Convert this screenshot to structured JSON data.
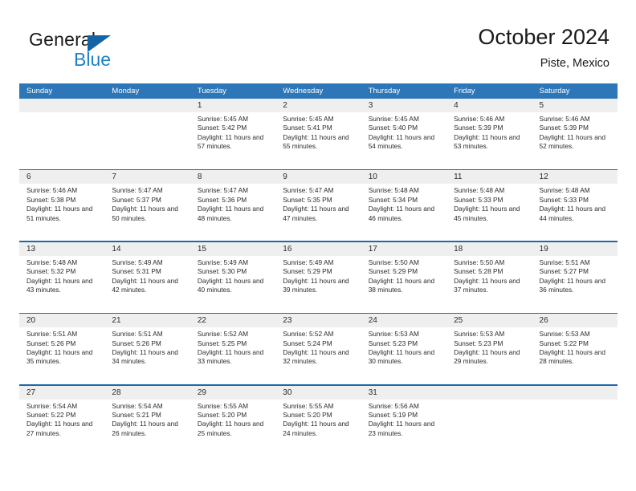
{
  "brand": {
    "name_part1": "General",
    "name_part2": "Blue",
    "triangle_icon": "triangle-icon",
    "accent_color": "#1f7fc4"
  },
  "header": {
    "title": "October 2024",
    "subtitle": "Piste, Mexico"
  },
  "colors": {
    "header_blue": "#2d76b8",
    "rule_blue": "#1f68ad",
    "daynum_band": "#efefef",
    "text": "#2b2b2b"
  },
  "weekdays": [
    "Sunday",
    "Monday",
    "Tuesday",
    "Wednesday",
    "Thursday",
    "Friday",
    "Saturday"
  ],
  "labels": {
    "sunrise_prefix": "Sunrise:",
    "sunset_prefix": "Sunset:",
    "daylight_prefix": "Daylight:"
  },
  "weeks": [
    {
      "days": [
        {
          "num": "",
          "sunrise": "",
          "sunset": "",
          "daylight": "",
          "empty": true
        },
        {
          "num": "",
          "sunrise": "",
          "sunset": "",
          "daylight": "",
          "empty": true
        },
        {
          "num": "1",
          "sunrise": "Sunrise: 5:45 AM",
          "sunset": "Sunset: 5:42 PM",
          "daylight": "Daylight: 11 hours and 57 minutes."
        },
        {
          "num": "2",
          "sunrise": "Sunrise: 5:45 AM",
          "sunset": "Sunset: 5:41 PM",
          "daylight": "Daylight: 11 hours and 55 minutes."
        },
        {
          "num": "3",
          "sunrise": "Sunrise: 5:45 AM",
          "sunset": "Sunset: 5:40 PM",
          "daylight": "Daylight: 11 hours and 54 minutes."
        },
        {
          "num": "4",
          "sunrise": "Sunrise: 5:46 AM",
          "sunset": "Sunset: 5:39 PM",
          "daylight": "Daylight: 11 hours and 53 minutes."
        },
        {
          "num": "5",
          "sunrise": "Sunrise: 5:46 AM",
          "sunset": "Sunset: 5:39 PM",
          "daylight": "Daylight: 11 hours and 52 minutes."
        }
      ]
    },
    {
      "days": [
        {
          "num": "6",
          "sunrise": "Sunrise: 5:46 AM",
          "sunset": "Sunset: 5:38 PM",
          "daylight": "Daylight: 11 hours and 51 minutes."
        },
        {
          "num": "7",
          "sunrise": "Sunrise: 5:47 AM",
          "sunset": "Sunset: 5:37 PM",
          "daylight": "Daylight: 11 hours and 50 minutes."
        },
        {
          "num": "8",
          "sunrise": "Sunrise: 5:47 AM",
          "sunset": "Sunset: 5:36 PM",
          "daylight": "Daylight: 11 hours and 48 minutes."
        },
        {
          "num": "9",
          "sunrise": "Sunrise: 5:47 AM",
          "sunset": "Sunset: 5:35 PM",
          "daylight": "Daylight: 11 hours and 47 minutes."
        },
        {
          "num": "10",
          "sunrise": "Sunrise: 5:48 AM",
          "sunset": "Sunset: 5:34 PM",
          "daylight": "Daylight: 11 hours and 46 minutes."
        },
        {
          "num": "11",
          "sunrise": "Sunrise: 5:48 AM",
          "sunset": "Sunset: 5:33 PM",
          "daylight": "Daylight: 11 hours and 45 minutes."
        },
        {
          "num": "12",
          "sunrise": "Sunrise: 5:48 AM",
          "sunset": "Sunset: 5:33 PM",
          "daylight": "Daylight: 11 hours and 44 minutes."
        }
      ]
    },
    {
      "days": [
        {
          "num": "13",
          "sunrise": "Sunrise: 5:48 AM",
          "sunset": "Sunset: 5:32 PM",
          "daylight": "Daylight: 11 hours and 43 minutes."
        },
        {
          "num": "14",
          "sunrise": "Sunrise: 5:49 AM",
          "sunset": "Sunset: 5:31 PM",
          "daylight": "Daylight: 11 hours and 42 minutes."
        },
        {
          "num": "15",
          "sunrise": "Sunrise: 5:49 AM",
          "sunset": "Sunset: 5:30 PM",
          "daylight": "Daylight: 11 hours and 40 minutes."
        },
        {
          "num": "16",
          "sunrise": "Sunrise: 5:49 AM",
          "sunset": "Sunset: 5:29 PM",
          "daylight": "Daylight: 11 hours and 39 minutes."
        },
        {
          "num": "17",
          "sunrise": "Sunrise: 5:50 AM",
          "sunset": "Sunset: 5:29 PM",
          "daylight": "Daylight: 11 hours and 38 minutes."
        },
        {
          "num": "18",
          "sunrise": "Sunrise: 5:50 AM",
          "sunset": "Sunset: 5:28 PM",
          "daylight": "Daylight: 11 hours and 37 minutes."
        },
        {
          "num": "19",
          "sunrise": "Sunrise: 5:51 AM",
          "sunset": "Sunset: 5:27 PM",
          "daylight": "Daylight: 11 hours and 36 minutes."
        }
      ]
    },
    {
      "days": [
        {
          "num": "20",
          "sunrise": "Sunrise: 5:51 AM",
          "sunset": "Sunset: 5:26 PM",
          "daylight": "Daylight: 11 hours and 35 minutes."
        },
        {
          "num": "21",
          "sunrise": "Sunrise: 5:51 AM",
          "sunset": "Sunset: 5:26 PM",
          "daylight": "Daylight: 11 hours and 34 minutes."
        },
        {
          "num": "22",
          "sunrise": "Sunrise: 5:52 AM",
          "sunset": "Sunset: 5:25 PM",
          "daylight": "Daylight: 11 hours and 33 minutes."
        },
        {
          "num": "23",
          "sunrise": "Sunrise: 5:52 AM",
          "sunset": "Sunset: 5:24 PM",
          "daylight": "Daylight: 11 hours and 32 minutes."
        },
        {
          "num": "24",
          "sunrise": "Sunrise: 5:53 AM",
          "sunset": "Sunset: 5:23 PM",
          "daylight": "Daylight: 11 hours and 30 minutes."
        },
        {
          "num": "25",
          "sunrise": "Sunrise: 5:53 AM",
          "sunset": "Sunset: 5:23 PM",
          "daylight": "Daylight: 11 hours and 29 minutes."
        },
        {
          "num": "26",
          "sunrise": "Sunrise: 5:53 AM",
          "sunset": "Sunset: 5:22 PM",
          "daylight": "Daylight: 11 hours and 28 minutes."
        }
      ]
    },
    {
      "days": [
        {
          "num": "27",
          "sunrise": "Sunrise: 5:54 AM",
          "sunset": "Sunset: 5:22 PM",
          "daylight": "Daylight: 11 hours and 27 minutes."
        },
        {
          "num": "28",
          "sunrise": "Sunrise: 5:54 AM",
          "sunset": "Sunset: 5:21 PM",
          "daylight": "Daylight: 11 hours and 26 minutes."
        },
        {
          "num": "29",
          "sunrise": "Sunrise: 5:55 AM",
          "sunset": "Sunset: 5:20 PM",
          "daylight": "Daylight: 11 hours and 25 minutes."
        },
        {
          "num": "30",
          "sunrise": "Sunrise: 5:55 AM",
          "sunset": "Sunset: 5:20 PM",
          "daylight": "Daylight: 11 hours and 24 minutes."
        },
        {
          "num": "31",
          "sunrise": "Sunrise: 5:56 AM",
          "sunset": "Sunset: 5:19 PM",
          "daylight": "Daylight: 11 hours and 23 minutes."
        },
        {
          "num": "",
          "sunrise": "",
          "sunset": "",
          "daylight": "",
          "empty": true
        },
        {
          "num": "",
          "sunrise": "",
          "sunset": "",
          "daylight": "",
          "empty": true
        }
      ]
    }
  ]
}
